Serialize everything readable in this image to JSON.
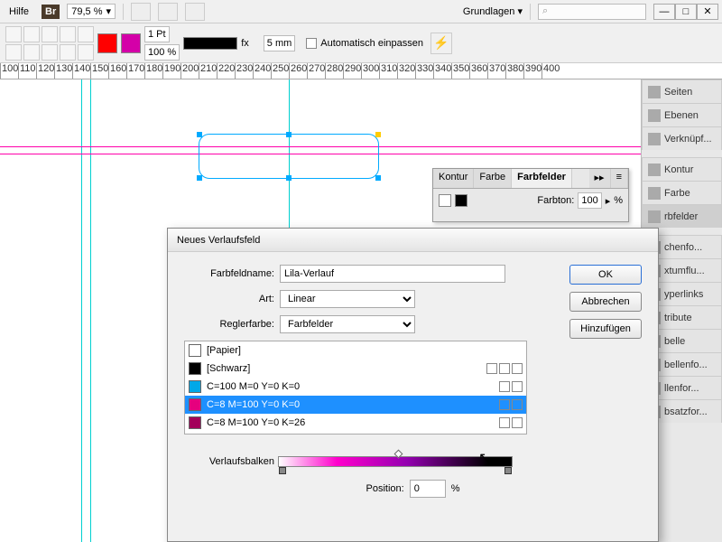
{
  "menu": {
    "hilfe": "Hilfe",
    "br": "Br",
    "zoom": "79,5 %",
    "grundlagen": "Grundlagen",
    "search_placeholder": "⌕"
  },
  "toolbar2": {
    "stroke": "1 Pt",
    "scale": "100 %",
    "gap": "5 mm",
    "autofit": "Automatisch einpassen"
  },
  "ruler": {
    "start": 100,
    "end": 400,
    "step": 10
  },
  "panels": {
    "top": [
      "Seiten",
      "Ebenen",
      "Verknüpf..."
    ],
    "mid": [
      "Kontur",
      "Farbe",
      "rbfelder"
    ],
    "low": [
      "chenfo...",
      "xtumflu...",
      "yperlinks",
      "tribute",
      "belle",
      "bellenfo...",
      "llenfor...",
      "bsatzfor..."
    ]
  },
  "swatchTabs": {
    "kontur": "Kontur",
    "farbe": "Farbe",
    "farbfelder": "Farbfelder",
    "farbton_label": "Farbton:",
    "farbton_value": "100",
    "farbton_unit": "%"
  },
  "dialog": {
    "title": "Neues Verlaufsfeld",
    "name_label": "Farbfeldname:",
    "name_value": "Lila-Verlauf",
    "type_label": "Art:",
    "type_value": "Linear",
    "stopcolor_label": "Reglerfarbe:",
    "stopcolor_value": "Farbfelder",
    "swatches": [
      {
        "name": "[Papier]",
        "color": "#ffffff",
        "sel": false,
        "icons": 0
      },
      {
        "name": "[Schwarz]",
        "color": "#000000",
        "sel": false,
        "icons": 3
      },
      {
        "name": "C=100 M=0 Y=0 K=0",
        "color": "#00a8e8",
        "sel": false,
        "icons": 2
      },
      {
        "name": "C=8 M=100 Y=0 K=0",
        "color": "#e6007e",
        "sel": true,
        "icons": 2
      },
      {
        "name": "C=8 M=100 Y=0 K=26",
        "color": "#a3005a",
        "sel": false,
        "icons": 2
      }
    ],
    "ramp_label": "Verlaufsbalken",
    "pos_label": "Position:",
    "pos_value": "0",
    "pos_unit": "%",
    "ok": "OK",
    "cancel": "Abbrechen",
    "add": "Hinzufügen"
  }
}
